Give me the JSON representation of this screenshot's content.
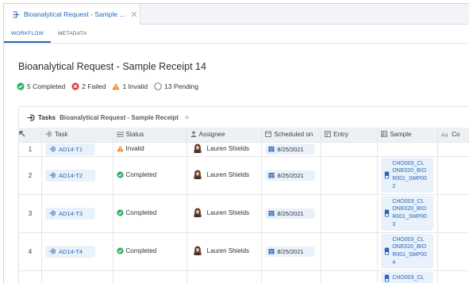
{
  "tab": {
    "title": "Bioanalytical Request - Sample ...",
    "icon": "request-icon"
  },
  "subnav": {
    "workflow": "WORKFLOW",
    "metadata": "METADATA"
  },
  "page": {
    "title": "Bioanalytical Request - Sample Receipt 14"
  },
  "status_summary": {
    "completed": "5 Completed",
    "failed": "2 Failed",
    "invalid": "1 Invalid",
    "pending": "13 Pending"
  },
  "colors": {
    "accent": "#2a66b6",
    "completed": "#2fb06a",
    "failed": "#e0434a",
    "invalid": "#f08a1c",
    "chip_bg": "#e9f1fb"
  },
  "tasks_panel": {
    "label": "Tasks",
    "subtitle": "Bioanalytical Request - Sample Receipt",
    "add": "+"
  },
  "table": {
    "columns": {
      "task": "Task",
      "status": "Status",
      "assignee": "Assignee",
      "scheduled": "Scheduled on",
      "entry": "Entry",
      "sample": "Sample",
      "co": "Co"
    },
    "rows": [
      {
        "num": "1",
        "task": "AD14-T1",
        "status": "Invalid",
        "status_type": "invalid",
        "assignee": "Lauren Shields",
        "scheduled": "8/25/2021",
        "entry": "",
        "sample": ""
      },
      {
        "num": "2",
        "task": "AD14-T2",
        "status": "Completed",
        "status_type": "completed",
        "assignee": "Lauren Shields",
        "scheduled": "8/25/2021",
        "entry": "",
        "sample": "CHO003_CLONE020_BIOR001_SMP002"
      },
      {
        "num": "3",
        "task": "AD14-T3",
        "status": "Completed",
        "status_type": "completed",
        "assignee": "Lauren Shields",
        "scheduled": "8/25/2021",
        "entry": "",
        "sample": "CHO003_CLONE020_BIOR001_SMP003"
      },
      {
        "num": "4",
        "task": "AD14-T4",
        "status": "Completed",
        "status_type": "completed",
        "assignee": "Lauren Shields",
        "scheduled": "8/25/2021",
        "entry": "",
        "sample": "CHO003_CLONE020_BIOR001_SMP004"
      },
      {
        "num": "",
        "task": "",
        "status": "",
        "status_type": "",
        "assignee": "",
        "scheduled": "",
        "entry": "",
        "sample": "CHO003_CL"
      }
    ]
  }
}
